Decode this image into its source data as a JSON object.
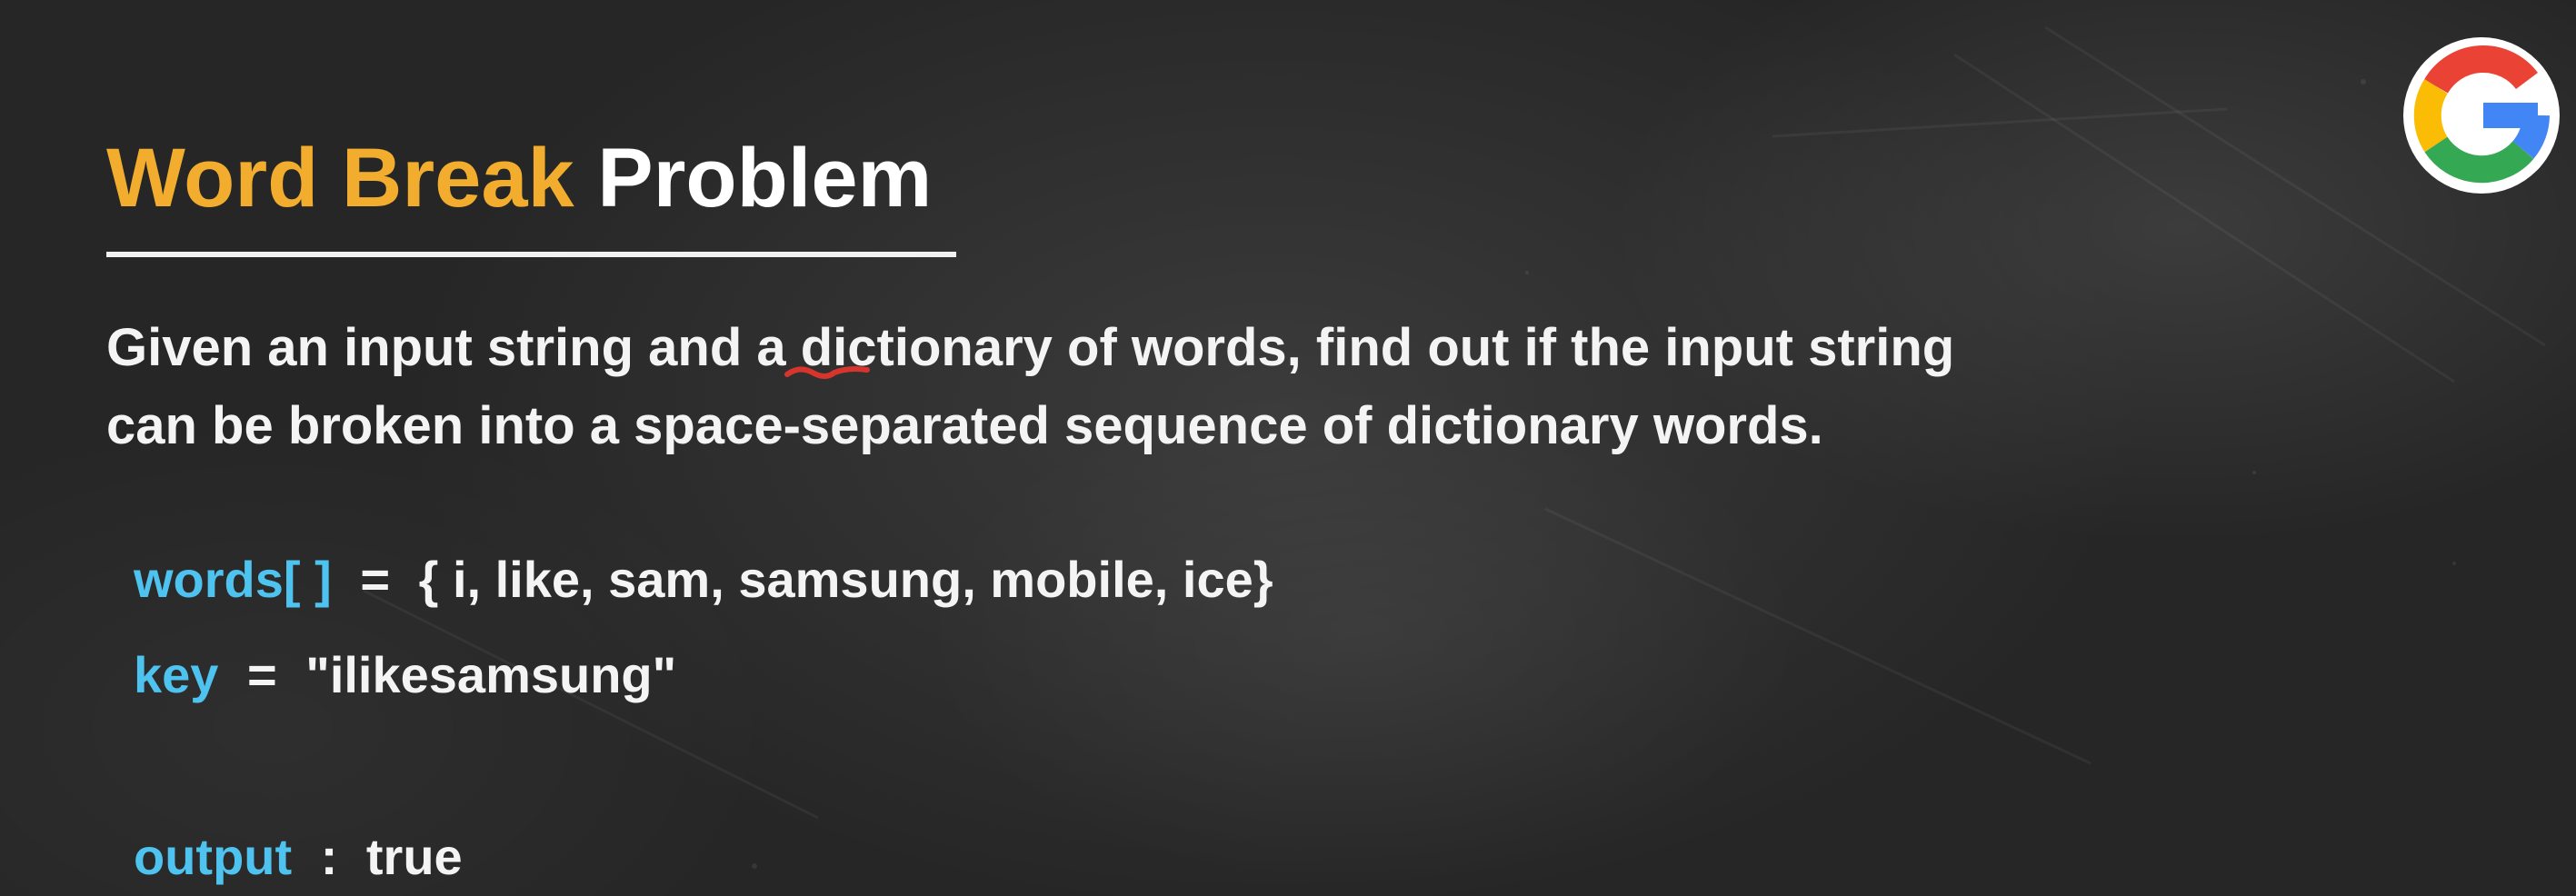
{
  "title": {
    "accent": "Word Break",
    "rest": "Problem"
  },
  "description": {
    "line1": "Given an input string and a dictionary of words, find out if the input string",
    "line2": "can be broken into a space-separated sequence of dictionary words."
  },
  "example": {
    "words": {
      "label": "words[ ]",
      "operator": "=",
      "value": "{ i, like, sam, samsung, mobile, ice}"
    },
    "key": {
      "label": "key",
      "operator": "=",
      "value": "\"ilikesamsung\""
    },
    "output": {
      "label": "output",
      "operator": ":",
      "value": "true"
    }
  },
  "logo": {
    "name": "google-g-logo",
    "colors": {
      "red": "#ea4335",
      "yellow": "#fbbc05",
      "green": "#34a853",
      "blue": "#4285f4"
    }
  },
  "colors": {
    "background": "#2a2a2a",
    "title_accent": "#f2ad2e",
    "code_key": "#4fc3ef",
    "annotation_underline": "#d8342e"
  }
}
